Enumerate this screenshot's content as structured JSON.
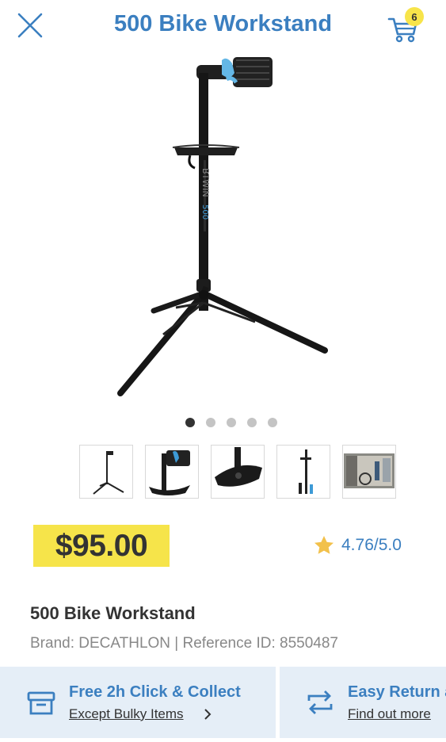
{
  "header": {
    "title": "500 Bike Workstand",
    "cart_count": "6"
  },
  "gallery": {
    "dot_count": 5,
    "active_dot": 1,
    "thumbnails": [
      "thumbnail-1",
      "thumbnail-2",
      "thumbnail-3",
      "thumbnail-4",
      "thumbnail-5"
    ]
  },
  "product": {
    "price": "$95.00",
    "rating": "4.76/5.0",
    "name": "500 Bike Workstand",
    "meta": "Brand: DECATHLON | Reference ID: 8550487"
  },
  "services": [
    {
      "title": "Free 2h Click & Collect",
      "link": "Except Bulky Items"
    },
    {
      "title": "Easy Return and Exchange",
      "link": "Find out more"
    }
  ],
  "colors": {
    "brand_blue": "#3b7fc0",
    "price_yellow": "#f6e44a",
    "service_bg": "#e5eef7",
    "star": "#f2c14b",
    "frame_blue": "#3d9ad6"
  },
  "icons": {
    "close": "close-icon",
    "cart": "cart-icon",
    "star": "star-icon",
    "collect": "store-box-icon",
    "return": "exchange-arrows-icon",
    "chevron": "chevron-right-icon"
  }
}
